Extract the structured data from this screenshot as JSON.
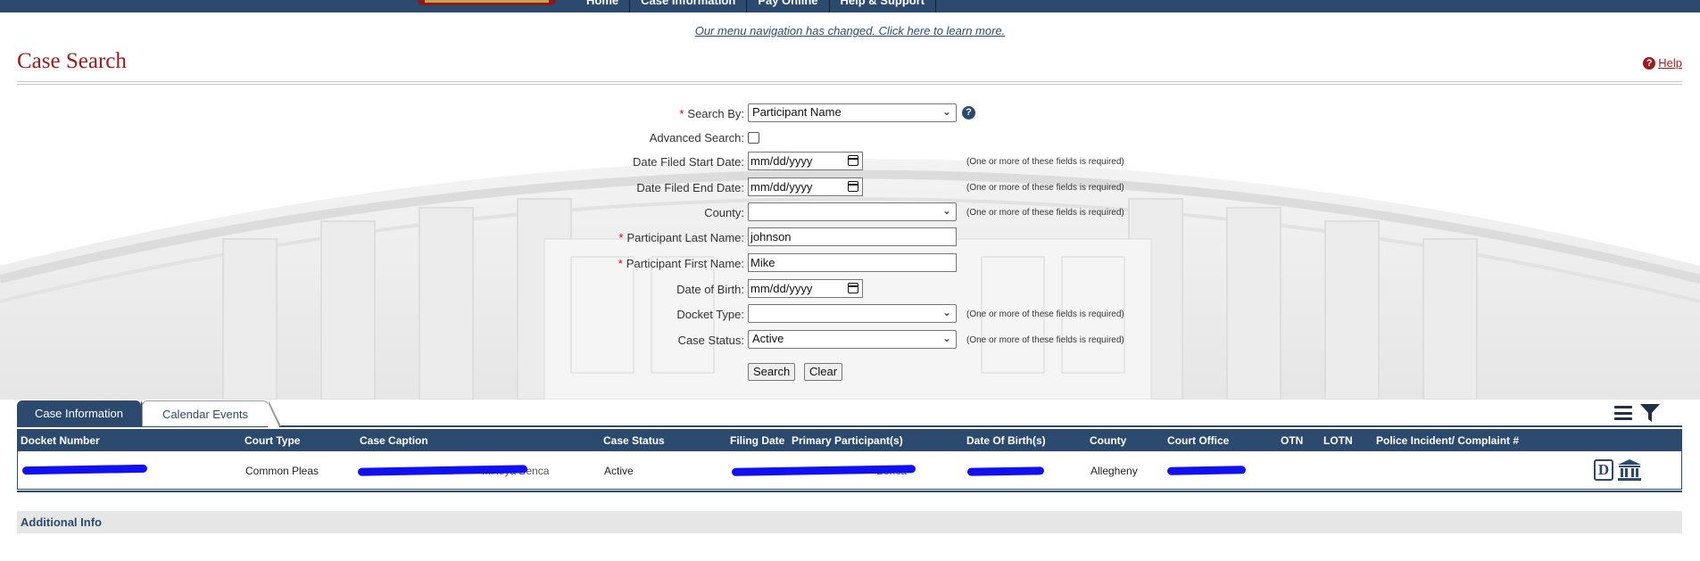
{
  "nav": {
    "items": [
      "Home",
      "Case Information",
      "Pay Online",
      "Help & Support"
    ],
    "notice": "Our menu navigation has changed. Click here to learn more."
  },
  "page": {
    "title": "Case Search",
    "help": "Help"
  },
  "form": {
    "search_by_label": "Search By:",
    "search_by_value": "Participant Name",
    "advanced_label": "Advanced Search:",
    "date_start_label": "Date Filed Start Date:",
    "date_end_label": "Date Filed End Date:",
    "county_label": "County:",
    "county_value": "",
    "last_name_label": "Participant Last Name:",
    "last_name_value": "johnson",
    "first_name_label": "Participant First Name:",
    "first_name_value": "Mike",
    "dob_label": "Date of Birth:",
    "docket_type_label": "Docket Type:",
    "docket_type_value": "",
    "case_status_label": "Case Status:",
    "case_status_value": "Active",
    "date_placeholder": "mm/dd/yyyy",
    "required_hint": "(One or more of these fields is required)",
    "search_button": "Search",
    "clear_button": "Clear"
  },
  "tabs": [
    "Case Information",
    "Calendar Events"
  ],
  "table": {
    "columns": [
      "Docket Number",
      "Court Type",
      "Case Caption",
      "Case Status",
      "Filing Date",
      "Primary Participant(s)",
      "Date Of Birth(s)",
      "County",
      "Court Office",
      "OTN",
      "LOTN",
      "Police Incident/ Complaint #"
    ],
    "rows": [
      {
        "court_type": "Common Pleas",
        "case_caption_visible": "Mikeya Benca",
        "case_status": "Active",
        "primary_participant_visible": "Benca",
        "county": "Allegheny"
      }
    ]
  },
  "additional_info": "Additional Info",
  "colors": {
    "navy": "#2c4a6e",
    "title_red": "#9b1c1c",
    "redaction": "#1010f0"
  }
}
